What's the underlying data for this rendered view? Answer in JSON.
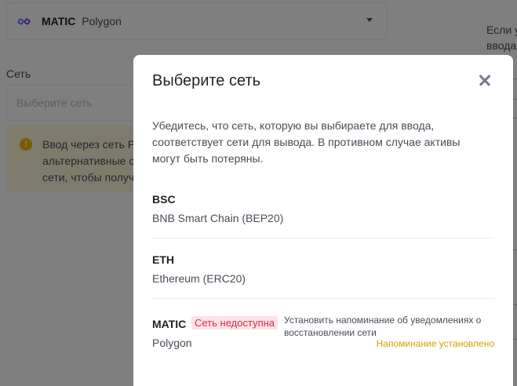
{
  "background": {
    "coin": {
      "ticker": "MATIC",
      "name": "Polygon"
    },
    "network_label": "Сеть",
    "network_placeholder": "Выберите сеть",
    "warning_lines": [
      "Ввод через сеть Р",
      "альтернативные с",
      "сети, чтобы получ"
    ],
    "side_lines": [
      "Если у",
      "ввода",
      "",
      "",
      ""
    ]
  },
  "modal": {
    "title": "Выберите сеть",
    "description": "Убедитесь, что сеть, которую вы выбираете для ввода, соответствует сети для вывода. В противном случае активы могут быть потеряны.",
    "networks": [
      {
        "code": "BSC",
        "name": "BNB Smart Chain (BEP20)"
      },
      {
        "code": "ETH",
        "name": "Ethereum (ERC20)"
      },
      {
        "code": "MATIC",
        "name": "Polygon",
        "status_badge": "Сеть недоступна",
        "reminder_text": "Установить напоминание об уведомлениях о восстановлении сети",
        "reminder_status": "Напоминание установлено"
      }
    ]
  },
  "colors": {
    "overlay": "rgba(0,0,0,0.5)",
    "badge_bg": "#fde2e6",
    "badge_text": "#cf304a",
    "reminder_status": "#d89f00",
    "warning_bg": "#fef6d8"
  }
}
